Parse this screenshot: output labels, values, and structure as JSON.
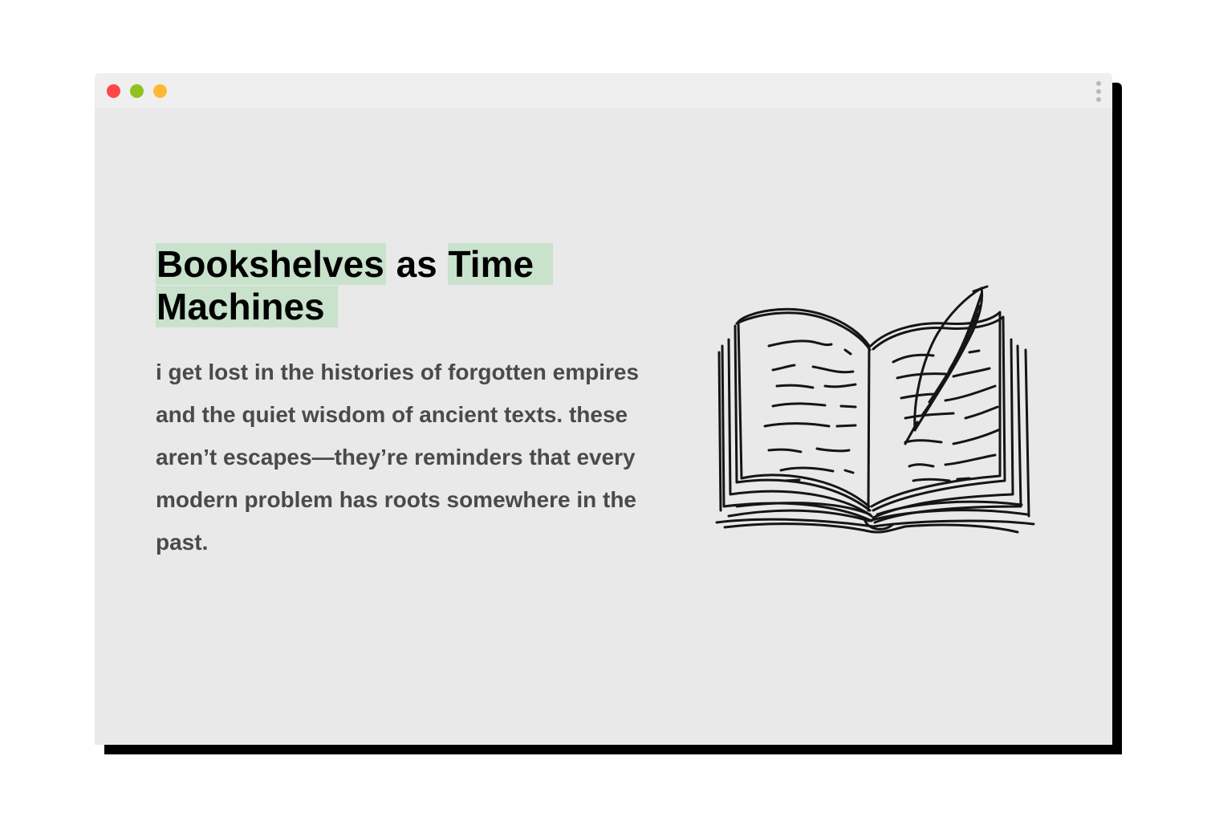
{
  "window": {
    "controls": {
      "close_color": "#ff4747",
      "minimize_color": "#8ec21c",
      "maximize_color": "#ffb833"
    },
    "menu_icon": "kebab-vertical-icon"
  },
  "post": {
    "title_parts": [
      "Bookshelves",
      "as",
      "Time",
      "Machines"
    ],
    "highlight_color": "#c8e2cc",
    "body": "i get lost in the histories of forgotten empires and the quiet wisdom of ancient texts. these aren’t escapes—they’re reminders that every modern problem has roots somewhere in the past.",
    "illustration": "open-book-with-quill-icon"
  }
}
